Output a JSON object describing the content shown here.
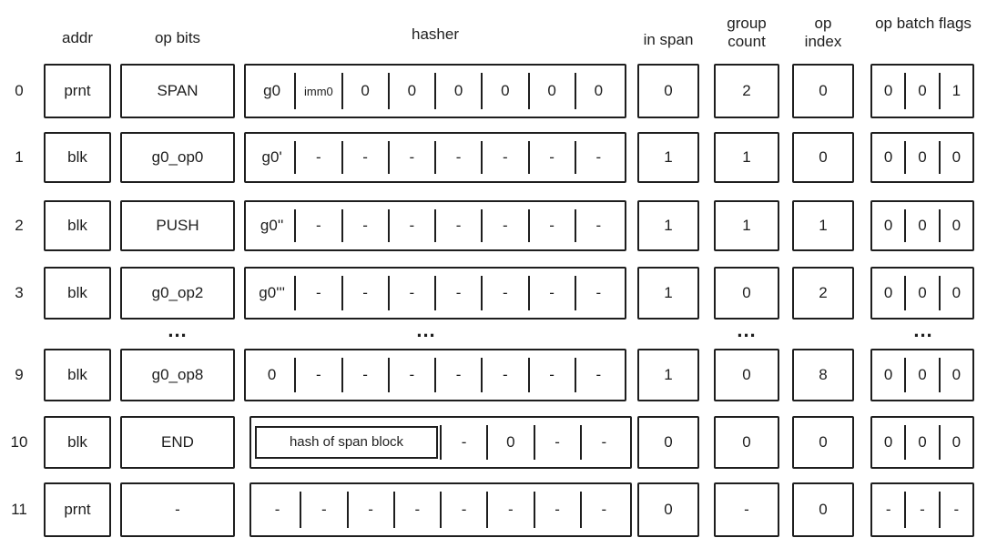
{
  "headers": {
    "addr": "addr",
    "op_bits": "op bits",
    "hasher": "hasher",
    "in_span": "in span",
    "group_count": "group count",
    "op_index": "op index",
    "op_batch_flags": "op batch flags"
  },
  "ellipsis": "...",
  "rows": [
    {
      "label": "0",
      "addr": "prnt",
      "op_bits": "SPAN",
      "hasher": [
        "g0",
        "imm0",
        "0",
        "0",
        "0",
        "0",
        "0",
        "0"
      ],
      "in_span": "0",
      "group_count": "2",
      "op_index": "0",
      "flags": [
        "0",
        "0",
        "1"
      ]
    },
    {
      "label": "1",
      "addr": "blk",
      "op_bits": "g0_op0",
      "hasher": [
        "g0'",
        "-",
        "-",
        "-",
        "-",
        "-",
        "-",
        "-"
      ],
      "in_span": "1",
      "group_count": "1",
      "op_index": "0",
      "flags": [
        "0",
        "0",
        "0"
      ]
    },
    {
      "label": "2",
      "addr": "blk",
      "op_bits": "PUSH",
      "hasher": [
        "g0''",
        "-",
        "-",
        "-",
        "-",
        "-",
        "-",
        "-"
      ],
      "in_span": "1",
      "group_count": "1",
      "op_index": "1",
      "flags": [
        "0",
        "0",
        "0"
      ]
    },
    {
      "label": "3",
      "addr": "blk",
      "op_bits": "g0_op2",
      "hasher": [
        "g0'''",
        "-",
        "-",
        "-",
        "-",
        "-",
        "-",
        "-"
      ],
      "in_span": "1",
      "group_count": "0",
      "op_index": "2",
      "flags": [
        "0",
        "0",
        "0"
      ]
    },
    {
      "label": "9",
      "addr": "blk",
      "op_bits": "g0_op8",
      "hasher": [
        "0",
        "-",
        "-",
        "-",
        "-",
        "-",
        "-",
        "-"
      ],
      "in_span": "1",
      "group_count": "0",
      "op_index": "8",
      "flags": [
        "0",
        "0",
        "0"
      ]
    },
    {
      "label": "10",
      "addr": "blk",
      "op_bits": "END",
      "hasher_span_label": "hash of span block",
      "hasher": [
        "-",
        "0",
        "-",
        "-"
      ],
      "in_span": "0",
      "group_count": "0",
      "op_index": "0",
      "flags": [
        "0",
        "0",
        "0"
      ]
    },
    {
      "label": "11",
      "addr": "prnt",
      "op_bits": "-",
      "hasher": [
        "-",
        "-",
        "-",
        "-",
        "-",
        "-",
        "-",
        "-"
      ],
      "in_span": "0",
      "group_count": "-",
      "op_index": "0",
      "flags": [
        "-",
        "-",
        "-"
      ]
    }
  ]
}
